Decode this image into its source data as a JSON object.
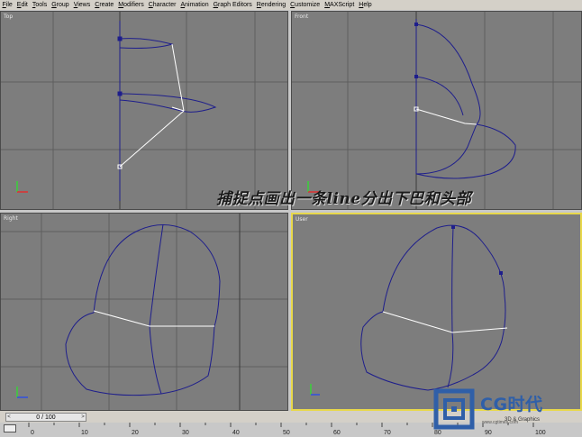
{
  "menu": [
    "File",
    "Edit",
    "Tools",
    "Group",
    "Views",
    "Create",
    "Modifiers",
    "Character",
    "Animation",
    "Graph Editors",
    "Rendering",
    "Customize",
    "MAXScript",
    "Help"
  ],
  "viewports": {
    "top": {
      "label": "Top"
    },
    "front": {
      "label": "Front"
    },
    "left": {
      "label": "Right"
    },
    "perspective": {
      "label": "User"
    }
  },
  "caption": "捕捉点画出一条line分出下巴和头部",
  "frame_counter": "0 / 100",
  "timeline_ticks": [
    "0",
    "10",
    "20",
    "30",
    "40",
    "50",
    "60",
    "70",
    "80",
    "90",
    "100"
  ],
  "logo": {
    "text": "CG时代",
    "sub": "3D & Graphics",
    "url": "www.cgtimes.com"
  },
  "colors": {
    "viewport_bg": "#7d7d7d",
    "spline": "#1e1e8c",
    "active_border": "#e8d84a",
    "logo": "#2f5fa8"
  }
}
